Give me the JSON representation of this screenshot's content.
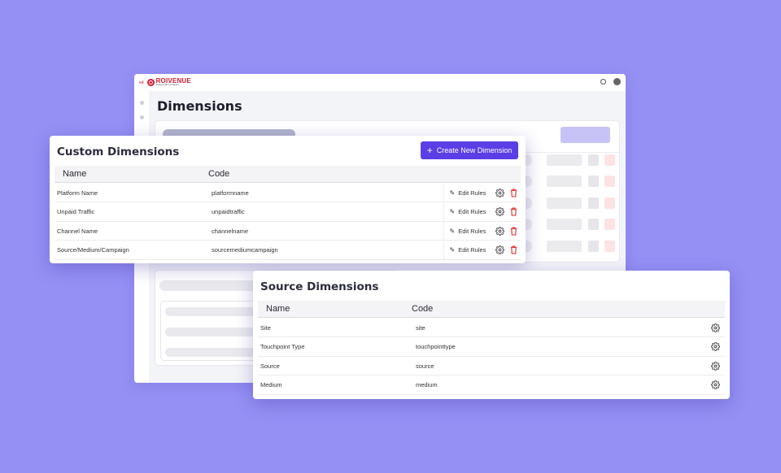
{
  "app": {
    "logo_name": "ROIVENUE",
    "logo_tagline": "Powered with AI Analytics",
    "window_mini_label": "ed",
    "page_title": "Dimensions"
  },
  "custom_dimensions": {
    "title": "Custom Dimensions",
    "create_button_label": "Create New Dimension",
    "columns": [
      "Name",
      "Code"
    ],
    "edit_label": "Edit Rules",
    "rows": [
      {
        "name": "Platform Name",
        "code": "platformname"
      },
      {
        "name": "Unpaid Traffic",
        "code": "unpaidtraffic"
      },
      {
        "name": "Channel Name",
        "code": "channelname"
      },
      {
        "name": "Source/Medium/Campaign",
        "code": "sourcemediumcampaign"
      }
    ]
  },
  "source_dimensions": {
    "title": "Source Dimensions",
    "columns": [
      "Name",
      "Code"
    ],
    "rows": [
      {
        "name": "Site",
        "code": "site"
      },
      {
        "name": "Touchpoint Type",
        "code": "touchpointtype"
      },
      {
        "name": "Source",
        "code": "source"
      },
      {
        "name": "Medium",
        "code": "medium"
      }
    ]
  },
  "colors": {
    "background": "#9590f4",
    "accent": "#5b3ee6",
    "brand": "#d7192e",
    "danger": "#e02424"
  }
}
